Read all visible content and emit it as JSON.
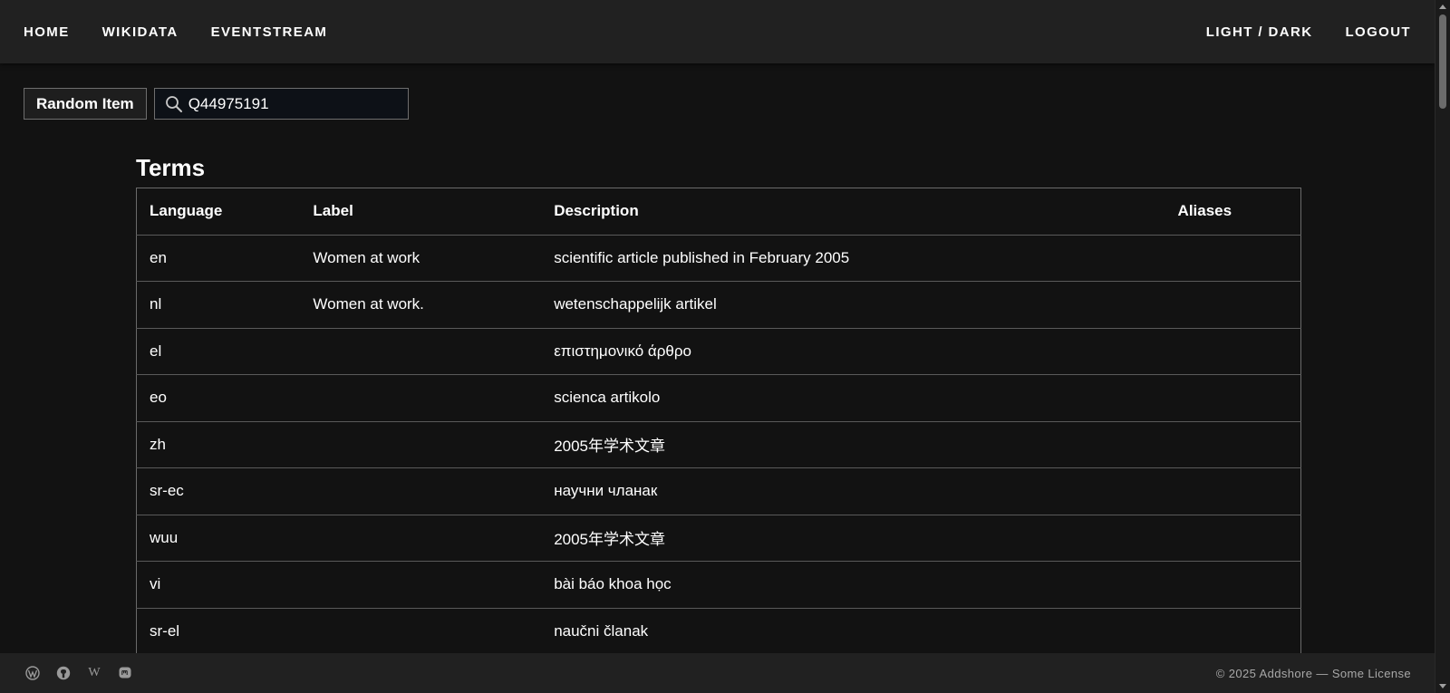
{
  "nav": {
    "left": [
      "HOME",
      "WIKIDATA",
      "EVENTSTREAM"
    ],
    "right": [
      "LIGHT / DARK",
      "LOGOUT"
    ]
  },
  "controls": {
    "random_label": "Random Item",
    "search_value": "Q44975191"
  },
  "terms": {
    "title": "Terms",
    "headers": {
      "language": "Language",
      "label": "Label",
      "description": "Description",
      "aliases": "Aliases"
    },
    "rows": [
      {
        "language": "en",
        "label": "Women at work",
        "description": "scientific article published in February 2005",
        "aliases": ""
      },
      {
        "language": "nl",
        "label": "Women at work.",
        "description": "wetenschappelijk artikel",
        "aliases": ""
      },
      {
        "language": "el",
        "label": "",
        "description": "επιστημονικό άρθρο",
        "aliases": ""
      },
      {
        "language": "eo",
        "label": "",
        "description": "scienca artikolo",
        "aliases": ""
      },
      {
        "language": "zh",
        "label": "",
        "description": "2005年学术文章",
        "aliases": ""
      },
      {
        "language": "sr-ec",
        "label": "",
        "description": "научни чланак",
        "aliases": ""
      },
      {
        "language": "wuu",
        "label": "",
        "description": "2005年学术文章",
        "aliases": ""
      },
      {
        "language": "vi",
        "label": "",
        "description": "bài báo khoa học",
        "aliases": ""
      },
      {
        "language": "sr-el",
        "label": "",
        "description": "naučni članak",
        "aliases": ""
      }
    ]
  },
  "footer": {
    "icons": [
      "wordpress-icon",
      "github-icon",
      "wikipedia-icon",
      "mastodon-icon"
    ],
    "wikipedia_glyph": "W",
    "copyright": "© 2025 Addshore — Some License"
  },
  "colors": {
    "background": "#121212",
    "bar": "#212121",
    "text": "#ffffff",
    "muted": "#a8a8a8"
  }
}
